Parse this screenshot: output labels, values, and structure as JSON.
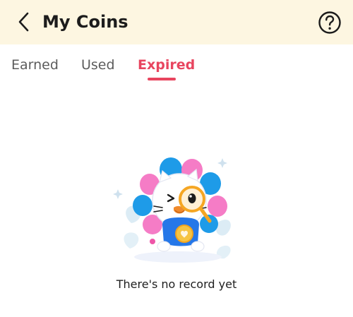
{
  "header": {
    "back_icon": "chevron-left-icon",
    "title": "My Coins",
    "help_icon": "question-circle-icon"
  },
  "tabs": [
    {
      "label": "Earned",
      "active": false
    },
    {
      "label": "Used",
      "active": false
    },
    {
      "label": "Expired",
      "active": true
    }
  ],
  "empty_state": {
    "message": "There's no record yet",
    "illustration": "flower-mascot-with-magnifier"
  },
  "colors": {
    "header_bg": "#fdf6e1",
    "accent": "#e8455f",
    "text_primary": "#1c1c1c",
    "text_inactive": "#5c5c5c"
  }
}
